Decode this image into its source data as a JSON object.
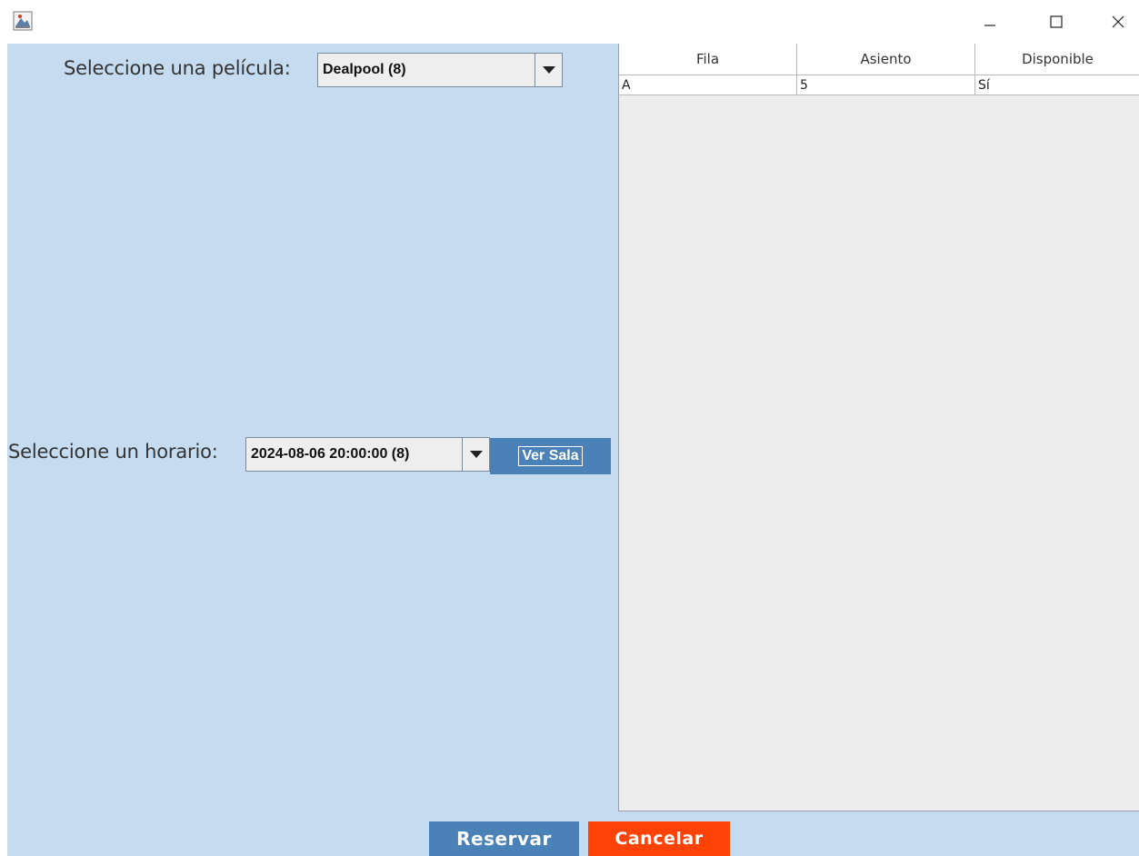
{
  "window": {
    "icon": "java-app-icon",
    "controls": {
      "minimize": "minimize-icon",
      "maximize": "maximize-icon",
      "close": "close-icon"
    }
  },
  "left": {
    "movie_label": "Seleccione una película:",
    "movie_selected": "Dealpool (8)",
    "schedule_label": "Seleccione un horario:",
    "schedule_selected": "2024-08-06 20:00:00 (8)",
    "ver_sala_label": "Ver Sala"
  },
  "table": {
    "headers": [
      "Fila",
      "Asiento",
      "Disponible"
    ],
    "rows": [
      [
        "A",
        "5",
        "Sí"
      ]
    ]
  },
  "footer": {
    "reservar_label": "Reservar",
    "cancelar_label": "Cancelar"
  },
  "colors": {
    "panel_bg": "#c5dbef",
    "primary_button": "#4a81b7",
    "cancel_button": "#ff4206",
    "table_bg": "#ededed"
  }
}
